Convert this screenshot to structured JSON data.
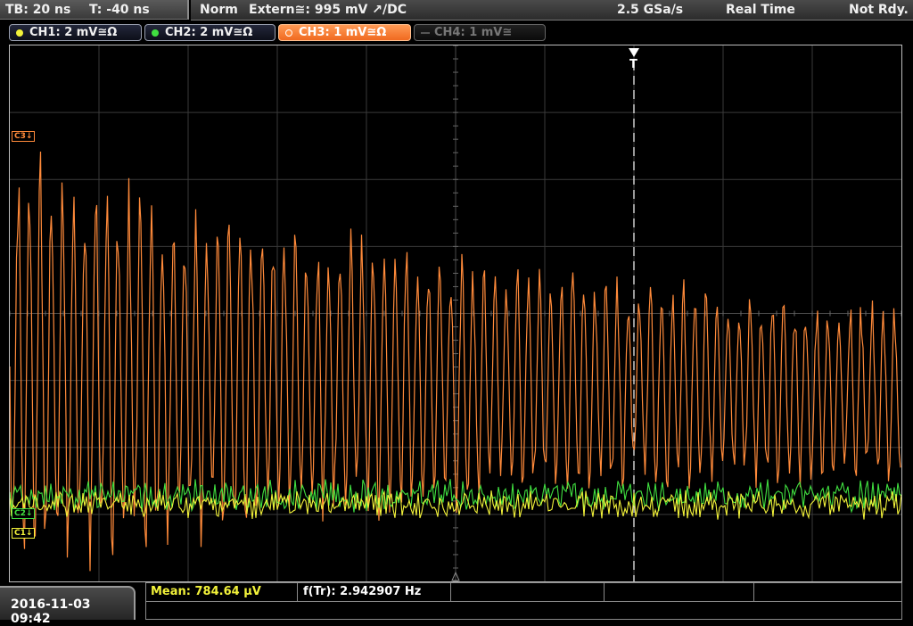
{
  "header": {
    "timebase": "TB: 20 ns",
    "trigger_time": "T: -40 ns",
    "trigger_mode": "Norm",
    "trigger_source": "Extern≅: 995 mV ↗/DC",
    "sample_rate": "2.5 GSa/s",
    "acq_mode": "Real Time",
    "status": "Not Rdy."
  },
  "channels": [
    {
      "label": "CH1: 2 mV≅Ω",
      "color": "#f2f23a",
      "state": "on"
    },
    {
      "label": "CH2: 2 mV≅Ω",
      "color": "#40e040",
      "state": "on"
    },
    {
      "label": "CH3: 1 mV≅Ω",
      "color": "#ff8a3a",
      "state": "active"
    },
    {
      "label": "CH4: 1 mV≅",
      "color": "#555555",
      "state": "off"
    }
  ],
  "markers": {
    "c3": "C3↓",
    "c2": "C2↓",
    "c1": "C1↓"
  },
  "trigger_marker": "T",
  "measurements": {
    "mean": "Mean: 784.64 µV",
    "freq": "f(Tr): 2.942907 Hz"
  },
  "datetime": "2016-11-03 09:42",
  "colors": {
    "ch1": "#f2f23a",
    "ch2": "#40e040",
    "ch3": "#ff8a3a",
    "grid": "#3a3a3a"
  }
}
